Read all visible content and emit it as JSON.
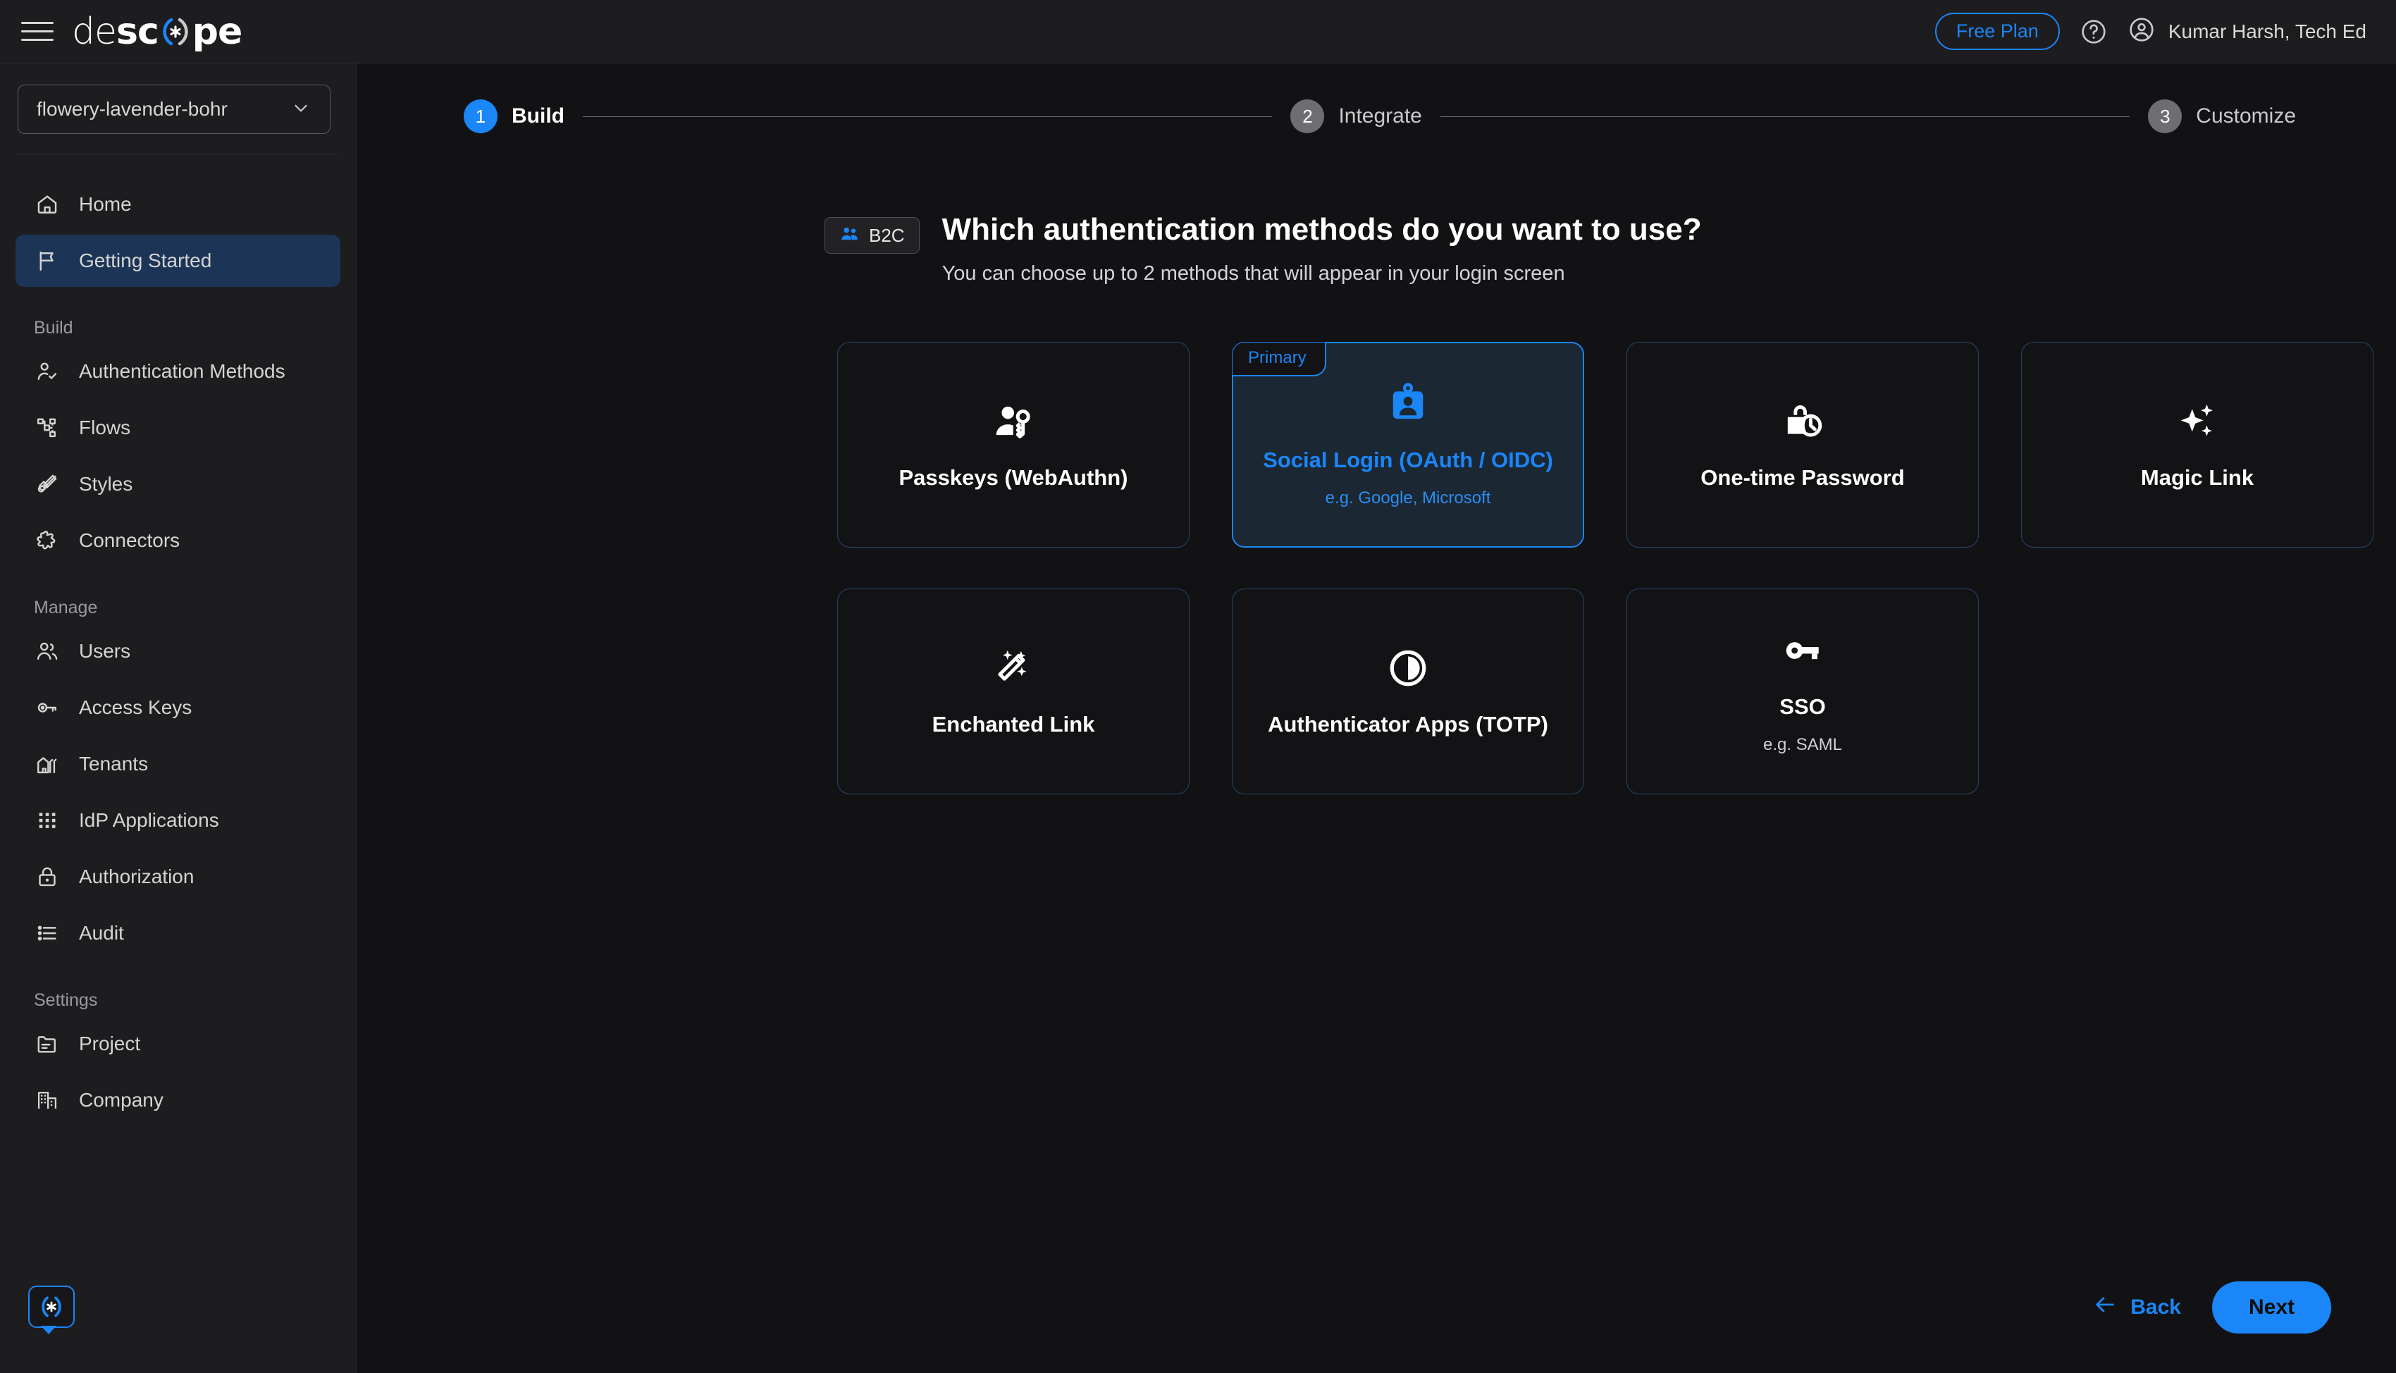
{
  "header": {
    "logo_part1": "de",
    "logo_part2": "sc",
    "logo_part3": "pe",
    "plan_label": "Free Plan",
    "user_name": "Kumar Harsh, Tech Ed"
  },
  "sidebar": {
    "project_name": "flowery-lavender-bohr",
    "top_items": [
      {
        "label": "Home",
        "icon": "home-icon",
        "active": false
      },
      {
        "label": "Getting Started",
        "icon": "flag-icon",
        "active": true
      }
    ],
    "groups": [
      {
        "title": "Build",
        "items": [
          {
            "label": "Authentication Methods",
            "icon": "user-check-icon"
          },
          {
            "label": "Flows",
            "icon": "flows-icon"
          },
          {
            "label": "Styles",
            "icon": "brush-icon"
          },
          {
            "label": "Connectors",
            "icon": "puzzle-icon"
          }
        ]
      },
      {
        "title": "Manage",
        "items": [
          {
            "label": "Users",
            "icon": "users-icon"
          },
          {
            "label": "Access Keys",
            "icon": "key-icon"
          },
          {
            "label": "Tenants",
            "icon": "buildings-icon"
          },
          {
            "label": "IdP Applications",
            "icon": "grid-dots-icon"
          },
          {
            "label": "Authorization",
            "icon": "lock-icon"
          },
          {
            "label": "Audit",
            "icon": "list-icon"
          }
        ]
      },
      {
        "title": "Settings",
        "items": [
          {
            "label": "Project",
            "icon": "folder-icon"
          },
          {
            "label": "Company",
            "icon": "company-icon"
          }
        ]
      }
    ]
  },
  "stepper": {
    "steps": [
      {
        "num": "1",
        "label": "Build",
        "state": "active"
      },
      {
        "num": "2",
        "label": "Integrate",
        "state": "inactive"
      },
      {
        "num": "3",
        "label": "Customize",
        "state": "inactive"
      }
    ]
  },
  "main": {
    "badge": "B2C",
    "title": "Which authentication methods do you want to use?",
    "subtitle": "You can choose up to 2 methods that will appear in your login screen",
    "cards": [
      {
        "title": "Passkeys (WebAuthn)",
        "sub": "",
        "icon": "user-key-icon",
        "selected": false,
        "tag": ""
      },
      {
        "title": "Social Login (OAuth / OIDC)",
        "sub": "e.g. Google, Microsoft",
        "icon": "id-badge-icon",
        "selected": true,
        "tag": "Primary"
      },
      {
        "title": "One-time Password",
        "sub": "",
        "icon": "lock-clock-icon",
        "selected": false,
        "tag": ""
      },
      {
        "title": "Magic Link",
        "sub": "",
        "icon": "sparkles-icon",
        "selected": false,
        "tag": ""
      },
      {
        "title": "Enchanted Link",
        "sub": "",
        "icon": "magic-wand-icon",
        "selected": false,
        "tag": ""
      },
      {
        "title": "Authenticator Apps (TOTP)",
        "sub": "",
        "icon": "clock-pie-icon",
        "selected": false,
        "tag": ""
      },
      {
        "title": "SSO",
        "sub": "e.g. SAML",
        "icon": "key-icon",
        "selected": false,
        "tag": ""
      }
    ]
  },
  "footer": {
    "back_label": "Back",
    "next_label": "Next"
  },
  "colors": {
    "accent": "#1a86f7",
    "sidebar_bg": "#1d1d1f",
    "main_bg": "#121214",
    "card_border": "#27456b",
    "selected_card_bg": "#1b2733"
  }
}
